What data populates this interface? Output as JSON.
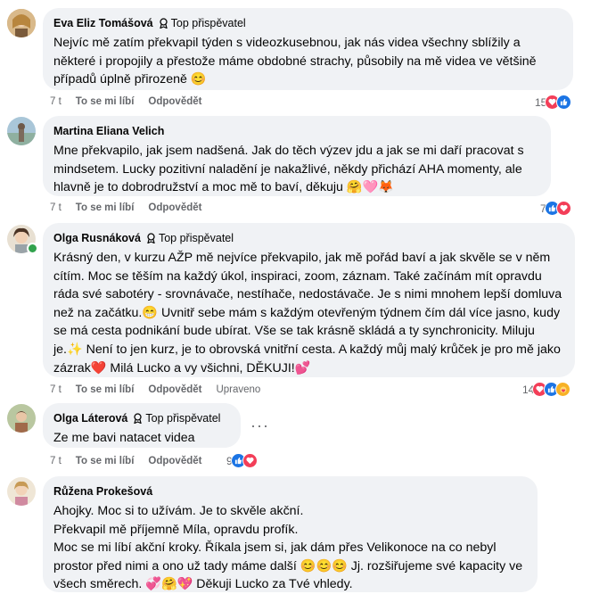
{
  "comments": [
    {
      "name": "Eva Eliz Tomášová",
      "badge": "Top přispěvatel",
      "text": "Nejvíc mě zatím překvapil týden s videozkusebnou, jak nás videa všechny sblížily a některé i propojily a přestože máme obdobné strachy, působily na mě videa ve většině případů úplně přirozeně 😊",
      "time": "7 t",
      "like_label": "To se mi líbí",
      "reply_label": "Odpovědět",
      "reaction_count": "15",
      "reaction_icons": [
        "love-reaction-icon",
        "like-reaction-icon"
      ]
    },
    {
      "name": "Martina Eliana Velich",
      "text": "Mne překvapilo, jak jsem nadšená. Jak do těch výzev jdu a jak se mi daří pracovat s mindsetem. Lucky pozitivní naladění je nakažlivé, někdy přichází AHA momenty, ale hlavně je to dobrodružství a moc mě to baví, děkuju 🤗🩷🦊",
      "time": "7 t",
      "like_label": "To se mi líbí",
      "reply_label": "Odpovědět",
      "reaction_count": "7",
      "reaction_icons": [
        "like-reaction-icon",
        "love-reaction-icon"
      ]
    },
    {
      "name": "Olga Rusnáková",
      "badge": "Top přispěvatel",
      "text": "Krásný den, v kurzu AŽP mě nejvíce překvapilo, jak mě pořád baví a jak skvěle se v něm cítím. Moc se těším na každý úkol, inspiraci, zoom, záznam. Také začínám mít opravdu ráda své sabotéry - srovnávače, nestíhače, nedostávače. Je s nimi mnohem lepší domluva než na začátku.😁 Uvnitř sebe mám s každým otevřeným týdnem čím dál více jasno, kudy se má cesta podnikání bude ubírat. Vše se tak krásně skládá a ty synchronicity. Miluju je.✨ Není to jen kurz, je to obrovská vnitřní cesta. A každý můj malý krůček je pro mě jako zázrak❤️ Milá Lucko a vy všichni, DĚKUJI!💕",
      "time": "7 t",
      "like_label": "To se mi líbí",
      "reply_label": "Odpovědět",
      "edited_label": "Upraveno",
      "reaction_count": "14",
      "reaction_icons": [
        "love-reaction-icon",
        "like-reaction-icon",
        "care-reaction-icon"
      ]
    },
    {
      "name": "Olga Láterová",
      "badge": "Top přispěvatel",
      "text": "Ze me bavi natacet videa",
      "time": "7 t",
      "like_label": "To se mi líbí",
      "reply_label": "Odpovědět",
      "reaction_count": "9",
      "reaction_icons": [
        "like-reaction-icon",
        "love-reaction-icon"
      ],
      "more_label": "···"
    },
    {
      "name": "Růžena Prokešová",
      "text": "Ahojky. Moc si to užívám. Je to skvěle akční.\nPřekvapil mě příjemně Míla, opravdu profík.\nMoc se mi líbí akční kroky. Říkala jsem si, jak dám přes Velikonoce na co nebyl prostor před nimi a ono už tady máme další 😊😊😊 Jj. rozšiřujeme své kapacity ve všech směrech. 💞🤗💖 Děkuji Lucko za Tvé vhledy."
    }
  ]
}
